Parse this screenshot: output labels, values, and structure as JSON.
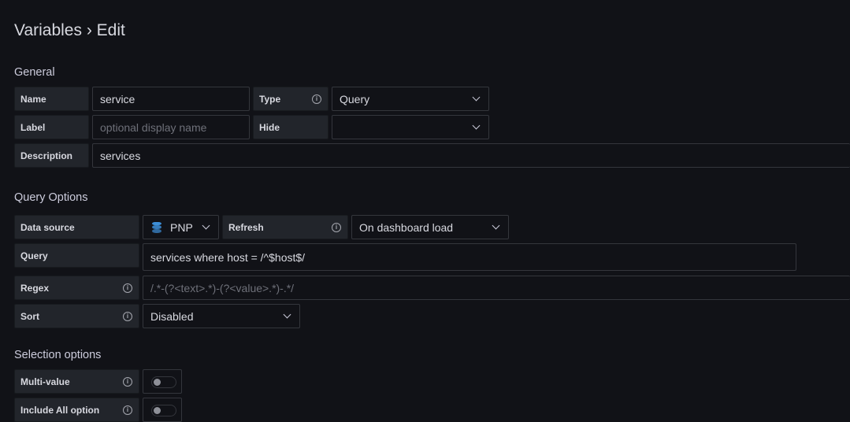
{
  "page": {
    "title": "Variables › Edit"
  },
  "general": {
    "heading": "General",
    "name_label": "Name",
    "name_value": "service",
    "type_label": "Type",
    "type_value": "Query",
    "label_label": "Label",
    "label_placeholder": "optional display name",
    "hide_label": "Hide",
    "hide_value": "",
    "description_label": "Description",
    "description_value": "services"
  },
  "query_options": {
    "heading": "Query Options",
    "datasource_label": "Data source",
    "datasource_value": "PNP",
    "refresh_label": "Refresh",
    "refresh_value": "On dashboard load",
    "query_label": "Query",
    "query_value": "services where host = /^$host$/",
    "regex_label": "Regex",
    "regex_placeholder": "/.*-(?<text>.*)-(?<value>.*)-.*/",
    "sort_label": "Sort",
    "sort_value": "Disabled"
  },
  "selection_options": {
    "heading": "Selection options",
    "multi_value_label": "Multi-value",
    "multi_value_on": false,
    "include_all_label": "Include All option",
    "include_all_on": false
  },
  "icons": {
    "info": "info-icon",
    "chevron": "chevron-down-icon",
    "datasource": "database-icon"
  },
  "colors": {
    "background": "#111217",
    "label_bg": "#22252b",
    "datasource_icon": "#3d8fd8"
  }
}
